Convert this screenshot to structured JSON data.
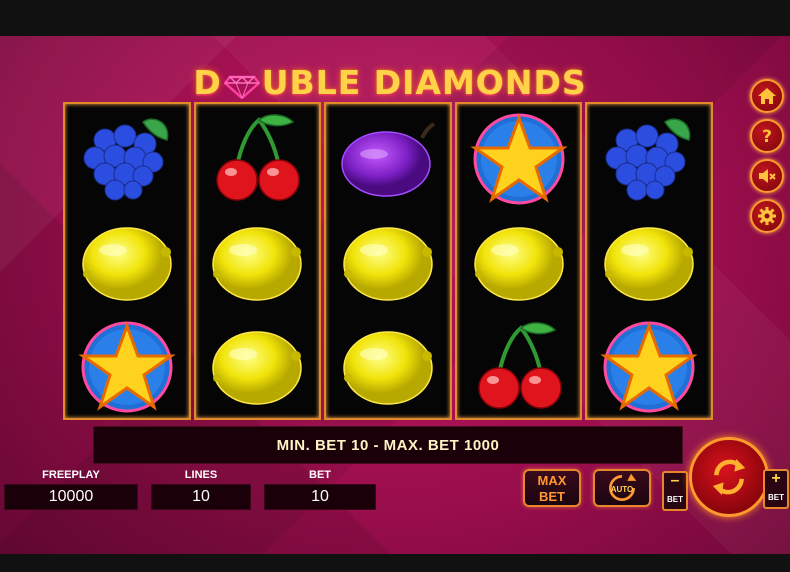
{
  "title": {
    "part1": "D",
    "part2": "UBLE DIAMONDS",
    "logo": "diamond-icon"
  },
  "reels": [
    [
      "grapes",
      "lemon",
      "star"
    ],
    [
      "cherries",
      "lemon",
      "lemon"
    ],
    [
      "plum",
      "lemon",
      "lemon"
    ],
    [
      "star",
      "lemon",
      "cherries"
    ],
    [
      "grapes",
      "lemon",
      "star"
    ]
  ],
  "info_text": "MIN. BET 10 - MAX. BET 1000",
  "fields": {
    "freeplay": {
      "label": "FREEPLAY",
      "value": "10000"
    },
    "lines": {
      "label": "LINES",
      "value": "10"
    },
    "bet": {
      "label": "BET",
      "value": "10"
    }
  },
  "buttons": {
    "max_bet_line1": "MAX",
    "max_bet_line2": "BET",
    "auto_label": "AUTO",
    "bet_minus_sign": "–",
    "bet_minus_label": "BET",
    "bet_plus_sign": "+",
    "bet_plus_label": "BET"
  },
  "side_icons": [
    "home-icon",
    "help-icon",
    "sound-off-icon",
    "settings-icon"
  ],
  "colors": {
    "background": "#a3104f",
    "accent": "#ff9a2c",
    "button_red": "#c1151d",
    "text_gold": "#ffd24a"
  }
}
